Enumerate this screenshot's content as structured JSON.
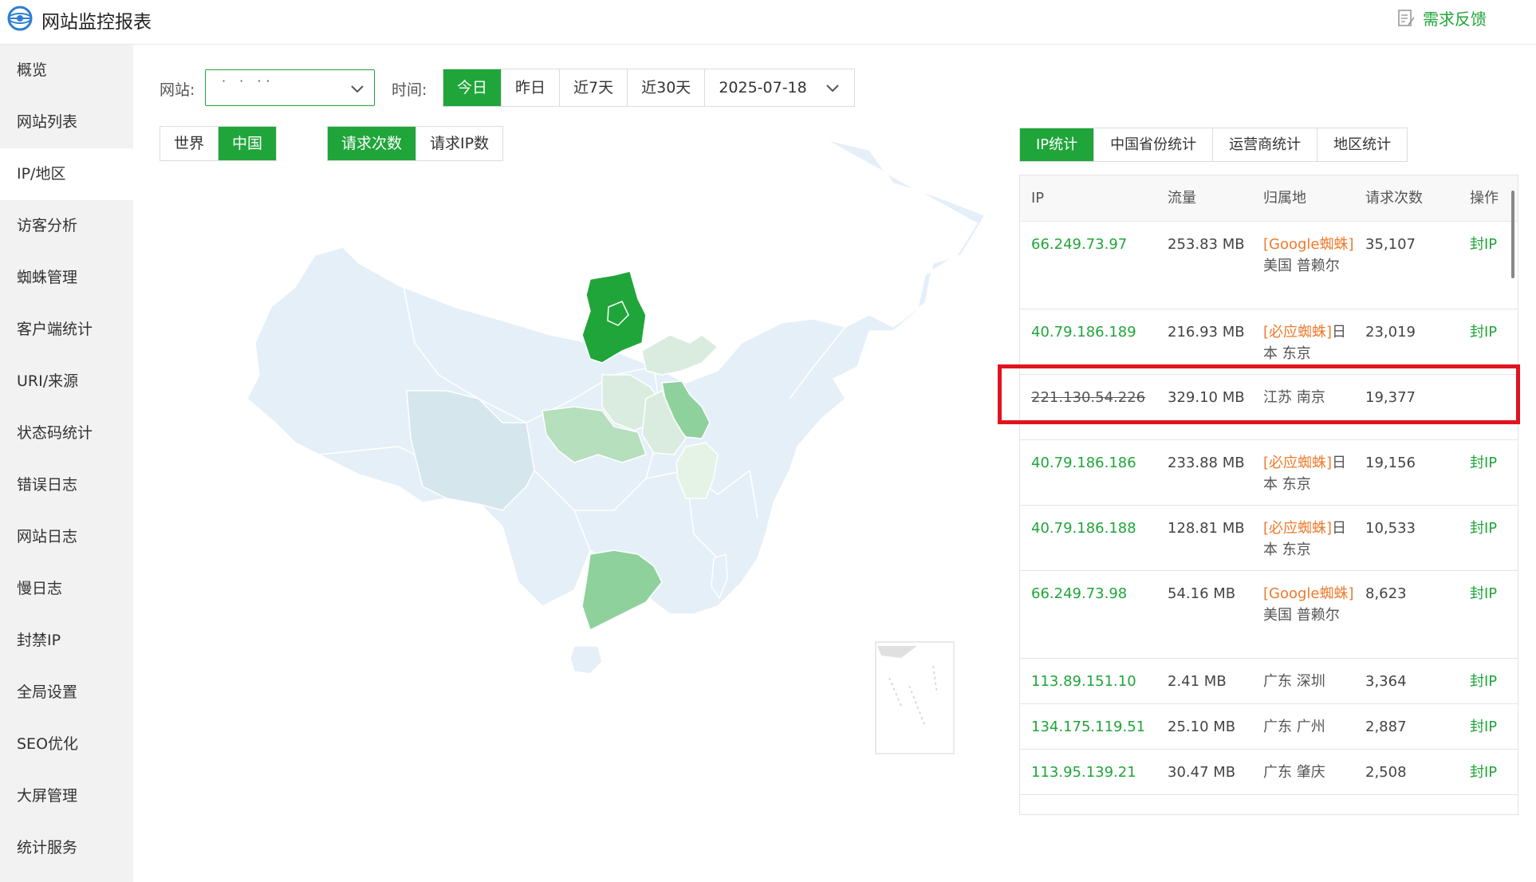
{
  "app": {
    "title": "网站监控报表",
    "feedback_label": "需求反馈"
  },
  "sidebar": {
    "items": [
      {
        "label": "概览"
      },
      {
        "label": "网站列表"
      },
      {
        "label": "IP/地区",
        "active": true
      },
      {
        "label": "访客分析"
      },
      {
        "label": "蜘蛛管理"
      },
      {
        "label": "客户端统计"
      },
      {
        "label": "URI/来源"
      },
      {
        "label": "状态码统计"
      },
      {
        "label": "错误日志"
      },
      {
        "label": "网站日志"
      },
      {
        "label": "慢日志"
      },
      {
        "label": "封禁IP"
      },
      {
        "label": "全局设置"
      },
      {
        "label": "SEO优化"
      },
      {
        "label": "大屏管理"
      },
      {
        "label": "统计服务"
      }
    ]
  },
  "toolbar": {
    "site_label": "网站:",
    "site_value": "· ·    ··",
    "time_label": "时间:",
    "time_options": [
      "今日",
      "昨日",
      "近7天",
      "近30天"
    ],
    "time_selected": "今日",
    "date_value": "2025-07-18"
  },
  "map_controls": {
    "region_toggle": [
      "世界",
      "中国"
    ],
    "region_selected": "中国",
    "metric_toggle": [
      "请求次数",
      "请求IP数"
    ],
    "metric_selected": "请求次数"
  },
  "map_colors": {
    "base": "#e4eff8",
    "light": "#d9ecdf",
    "mid_light": "#b6dfbd",
    "mid": "#8fd19c",
    "strong": "#20a53a"
  },
  "stats_tabs": {
    "items": [
      "IP统计",
      "中国省份统计",
      "运营商统计",
      "地区统计"
    ],
    "selected": "IP统计"
  },
  "ip_table": {
    "columns": [
      "IP",
      "流量",
      "归属地",
      "请求次数",
      "操作"
    ],
    "rows": [
      {
        "ip": "66.249.73.97",
        "flow": "253.83 MB",
        "tag": "[Google蜘蛛]",
        "location": "美国 普赖尔",
        "requests": "35,107",
        "action": "封IP"
      },
      {
        "ip": "40.79.186.189",
        "flow": "216.93 MB",
        "tag": "[必应蜘蛛]",
        "location": "日本 东京",
        "requests": "23,019",
        "action": "封IP"
      },
      {
        "ip": "221.130.54.226",
        "flow": "329.10 MB",
        "tag": "",
        "location": "江苏 南京",
        "requests": "19,377",
        "action": "",
        "struck": true
      },
      {
        "ip": "40.79.186.186",
        "flow": "233.88 MB",
        "tag": "[必应蜘蛛]",
        "location": "日本 东京",
        "requests": "19,156",
        "action": "封IP"
      },
      {
        "ip": "40.79.186.188",
        "flow": "128.81 MB",
        "tag": "[必应蜘蛛]",
        "location": "日本 东京",
        "requests": "10,533",
        "action": "封IP"
      },
      {
        "ip": "66.249.73.98",
        "flow": "54.16 MB",
        "tag": "[Google蜘蛛]",
        "location": "美国 普赖尔",
        "requests": "8,623",
        "action": "封IP"
      },
      {
        "ip": "113.89.151.10",
        "flow": "2.41 MB",
        "tag": "",
        "location": "广东 深圳",
        "requests": "3,364",
        "action": "封IP"
      },
      {
        "ip": "134.175.119.51",
        "flow": "25.10 MB",
        "tag": "",
        "location": "广东 广州",
        "requests": "2,887",
        "action": "封IP"
      },
      {
        "ip": "113.95.139.21",
        "flow": "30.47 MB",
        "tag": "",
        "location": "广东 肇庆",
        "requests": "2,508",
        "action": "封IP"
      }
    ]
  }
}
